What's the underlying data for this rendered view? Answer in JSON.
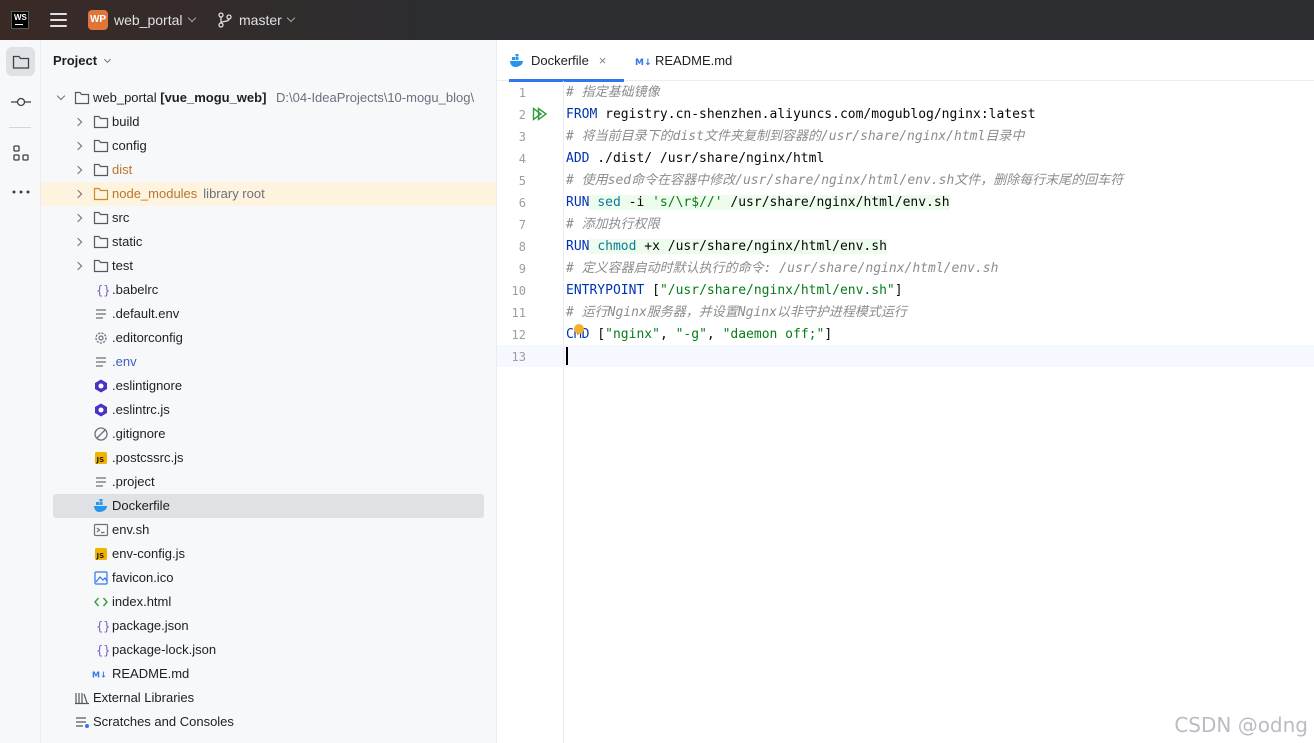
{
  "titlebar": {
    "logo": "WS",
    "project_badge": "WP",
    "project_name": "web_portal",
    "branch": "master"
  },
  "project_panel": {
    "title": "Project",
    "root": {
      "name": "web_portal",
      "module": "[vue_mogu_web]",
      "path": "D:\\04-IdeaProjects\\10-mogu_blog\\"
    },
    "folders": [
      {
        "name": "build"
      },
      {
        "name": "config"
      },
      {
        "name": "dist"
      },
      {
        "name": "node_modules",
        "note": "library root"
      },
      {
        "name": "src"
      },
      {
        "name": "static"
      },
      {
        "name": "test"
      }
    ],
    "files": [
      {
        "name": ".babelrc",
        "icon": "json-braces-icon"
      },
      {
        "name": ".default.env",
        "icon": "text-file-icon"
      },
      {
        "name": ".editorconfig",
        "icon": "gear-file-icon"
      },
      {
        "name": ".env",
        "icon": "text-file-icon"
      },
      {
        "name": ".eslintignore",
        "icon": "eslint-icon"
      },
      {
        "name": ".eslintrc.js",
        "icon": "eslint-icon"
      },
      {
        "name": ".gitignore",
        "icon": "ignore-file-icon"
      },
      {
        "name": ".postcssrc.js",
        "icon": "js-file-icon"
      },
      {
        "name": ".project",
        "icon": "text-file-icon"
      },
      {
        "name": "Dockerfile",
        "icon": "docker-icon"
      },
      {
        "name": "env.sh",
        "icon": "terminal-file-icon"
      },
      {
        "name": "env-config.js",
        "icon": "js-file-icon"
      },
      {
        "name": "favicon.ico",
        "icon": "image-file-icon"
      },
      {
        "name": "index.html",
        "icon": "html-file-icon"
      },
      {
        "name": "package.json",
        "icon": "json-braces-icon"
      },
      {
        "name": "package-lock.json",
        "icon": "json-braces-icon"
      },
      {
        "name": "README.md",
        "icon": "markdown-icon"
      }
    ],
    "external_libraries": "External Libraries",
    "scratches": "Scratches and Consoles"
  },
  "editor": {
    "tabs": [
      {
        "label": "Dockerfile",
        "close": "×"
      },
      {
        "label": "README.md"
      }
    ],
    "line_numbers": [
      "1",
      "2",
      "3",
      "4",
      "5",
      "6",
      "7",
      "8",
      "9",
      "10",
      "11",
      "12",
      "13"
    ],
    "code": {
      "l1": "# 指定基础镜像",
      "l2_kw": "FROM",
      "l2_rest": " registry.cn-shenzhen.aliyuncs.com/mogublog/nginx:latest",
      "l3": "# 将当前目录下的dist文件夹复制到容器的/usr/share/nginx/html目录中",
      "l4_kw": "ADD",
      "l4_rest": " ./dist/ /usr/share/nginx/html",
      "l5": "# 使用sed命令在容器中修改/usr/share/nginx/html/env.sh文件，删除每行末尾的回车符",
      "l6_kw": "RUN",
      "l6_cmd": "sed",
      "l6_flag": " -i ",
      "l6_str": "'s/\\r$//'",
      "l6_rest": " /usr/share/nginx/html/env.sh",
      "l7": "# 添加执行权限",
      "l8_kw": "RUN",
      "l8_cmd": "chmod",
      "l8_rest": " +x /usr/share/nginx/html/env.sh",
      "l9": "# 定义容器启动时默认执行的命令: /usr/share/nginx/html/env.sh",
      "l10_kw": "ENTRYPOINT",
      "l10_open": " [",
      "l10_str": "\"/usr/share/nginx/html/env.sh\"",
      "l10_close": "]",
      "l11": "# 运行Nginx服务器，并设置Nginx以非守护进程模式运行",
      "l12_kw": "CMD",
      "l12_open": " [",
      "l12_s1": "\"nginx\"",
      "l12_c1": ", ",
      "l12_s2": "\"-g\"",
      "l12_c2": ", ",
      "l12_s3": "\"daemon off;\"",
      "l12_close": "]"
    }
  },
  "watermark": "CSDN @odng",
  "colors": {
    "accent": "#3574f0",
    "keyword": "#0033b3",
    "string": "#067d17",
    "comment": "#8c8c8c",
    "excluded": "#b8772c"
  }
}
